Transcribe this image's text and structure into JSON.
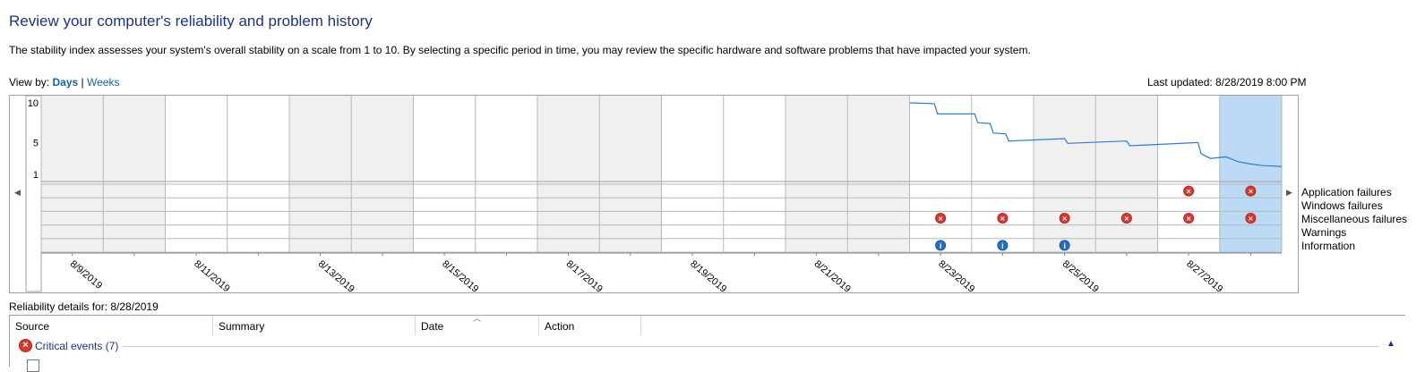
{
  "header": {
    "title": "Review your computer's reliability and problem history",
    "description": "The stability index assesses your system's overall stability on a scale from 1 to 10. By selecting a specific period in time, you may review the specific hardware and software problems that have impacted your system.",
    "view_by_label": "View by:",
    "view_days": "Days",
    "view_separator": "|",
    "view_weeks": "Weeks",
    "last_updated": "Last updated: 8/28/2019 8:00 PM"
  },
  "chart_data": {
    "type": "line",
    "y_ticks": [
      "10",
      "5",
      "1"
    ],
    "ylim": [
      1,
      10
    ],
    "x_labels": [
      "8/9/2019",
      "8/11/2019",
      "8/13/2019",
      "8/15/2019",
      "8/17/2019",
      "8/19/2019",
      "8/21/2019",
      "8/23/2019",
      "8/25/2019",
      "8/27/2019"
    ],
    "day_count": 20,
    "selected_day": "8/28/2019",
    "stability_index": [
      {
        "t": 14.0,
        "y": 10.0
      },
      {
        "t": 14.4,
        "y": 9.9
      },
      {
        "t": 14.45,
        "y": 8.6
      },
      {
        "t": 15.05,
        "y": 8.6
      },
      {
        "t": 15.1,
        "y": 7.5
      },
      {
        "t": 15.3,
        "y": 7.4
      },
      {
        "t": 15.35,
        "y": 6.2
      },
      {
        "t": 15.55,
        "y": 6.1
      },
      {
        "t": 15.6,
        "y": 5.2
      },
      {
        "t": 16.5,
        "y": 5.5
      },
      {
        "t": 16.55,
        "y": 4.9
      },
      {
        "t": 17.5,
        "y": 5.2
      },
      {
        "t": 17.55,
        "y": 4.6
      },
      {
        "t": 18.65,
        "y": 5.0
      },
      {
        "t": 18.7,
        "y": 3.6
      },
      {
        "t": 18.85,
        "y": 3.0
      },
      {
        "t": 19.1,
        "y": 3.2
      },
      {
        "t": 19.3,
        "y": 2.6
      },
      {
        "t": 19.5,
        "y": 2.3
      },
      {
        "t": 19.7,
        "y": 2.1
      },
      {
        "t": 20.0,
        "y": 2.0
      }
    ],
    "event_rows": [
      "Application failures",
      "Windows failures",
      "Miscellaneous failures",
      "Warnings",
      "Information"
    ],
    "events": [
      {
        "row": 0,
        "day": 18,
        "kind": "error"
      },
      {
        "row": 0,
        "day": 19,
        "kind": "error"
      },
      {
        "row": 2,
        "day": 14,
        "kind": "error"
      },
      {
        "row": 2,
        "day": 15,
        "kind": "error"
      },
      {
        "row": 2,
        "day": 16,
        "kind": "error"
      },
      {
        "row": 2,
        "day": 17,
        "kind": "error"
      },
      {
        "row": 2,
        "day": 18,
        "kind": "error"
      },
      {
        "row": 2,
        "day": 19,
        "kind": "error"
      },
      {
        "row": 4,
        "day": 14,
        "kind": "info"
      },
      {
        "row": 4,
        "day": 15,
        "kind": "info"
      },
      {
        "row": 4,
        "day": 16,
        "kind": "info"
      }
    ],
    "colors": {
      "line": "#2b7bd1",
      "shade": "#f0f0f0",
      "selected": "#bcd9f5",
      "error": "#d9372b",
      "info": "#1f6fc5",
      "grid": "#b8b8b8"
    }
  },
  "legend": {
    "application_failures": "Application failures",
    "windows_failures": "Windows failures",
    "misc_failures": "Miscellaneous failures",
    "warnings": "Warnings",
    "information": "Information"
  },
  "details": {
    "label": "Reliability details for: 8/28/2019",
    "columns": {
      "source": "Source",
      "summary": "Summary",
      "date": "Date",
      "action": "Action"
    },
    "critical_events": "Critical events (7)",
    "critical_icon": "error-circle-icon"
  }
}
